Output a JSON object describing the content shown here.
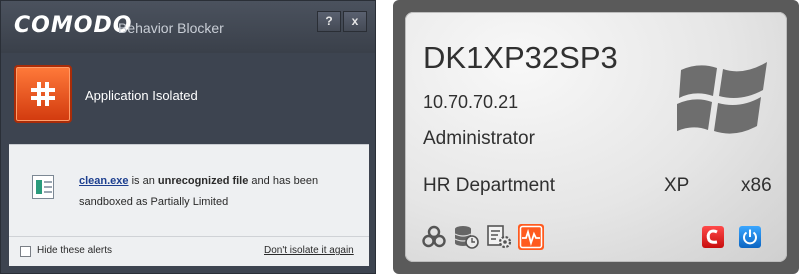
{
  "comodo": {
    "brand": "COMODO",
    "product": "Behavior Blocker",
    "help_label": "?",
    "close_label": "x",
    "status": "Application Isolated",
    "message": {
      "file": "clean.exe",
      "part1": " is an ",
      "emphasis": "unrecognized file",
      "part2": " and has been",
      "line2": "sandboxed as Partially Limited"
    },
    "hide_alerts_label": "Hide these alerts",
    "dont_isolate_label": "Don't isolate it again",
    "accent_color": "#e04a14"
  },
  "system": {
    "hostname": "DK1XP32SP3",
    "ip": "10.70.70.21",
    "user": "Administrator",
    "department": "HR Department",
    "os": "XP",
    "arch": "x86",
    "icons": [
      "biohazard-icon",
      "database-clock-icon",
      "config-icon",
      "pulse-monitor-icon",
      "comodo-c-icon",
      "power-icon"
    ]
  }
}
